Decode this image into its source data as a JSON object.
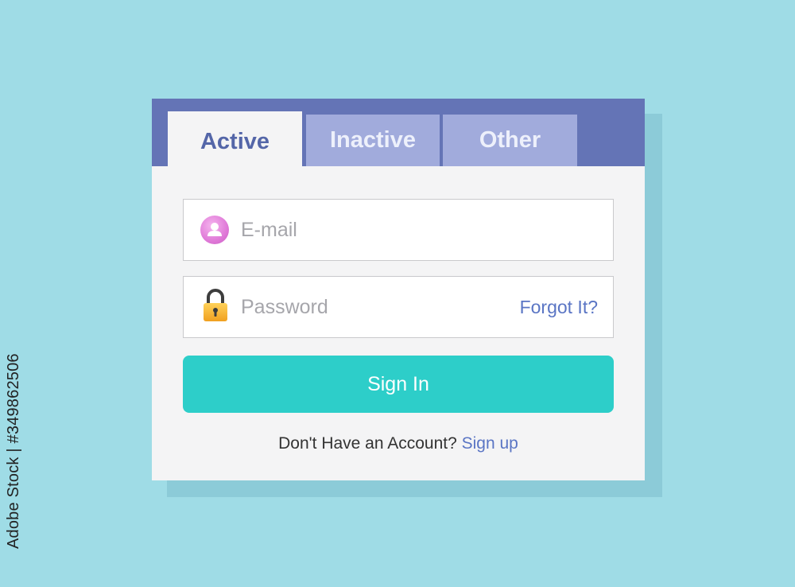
{
  "tabs": [
    {
      "label": "Active",
      "state": "active"
    },
    {
      "label": "Inactive",
      "state": "inactive"
    },
    {
      "label": "Other",
      "state": "inactive"
    }
  ],
  "email_field": {
    "placeholder": "E-mail",
    "value": "",
    "icon": "user-icon"
  },
  "password_field": {
    "placeholder": "Password",
    "value": "",
    "icon": "lock-icon",
    "forgot_label": "Forgot It?"
  },
  "signin_button": {
    "label": "Sign In"
  },
  "signup": {
    "prompt": "Don't Have an Account?",
    "link_label": "Sign up"
  },
  "side_text": "Adobe Stock | #349862506",
  "colors": {
    "background": "#9fdce6",
    "tab_bar": "#6474b6",
    "inactive_tab": "#a1abdc",
    "active_tab_text": "#5466a8",
    "card": "#f4f4f5",
    "accent_button": "#2dcec9",
    "link": "#5a75c4"
  }
}
